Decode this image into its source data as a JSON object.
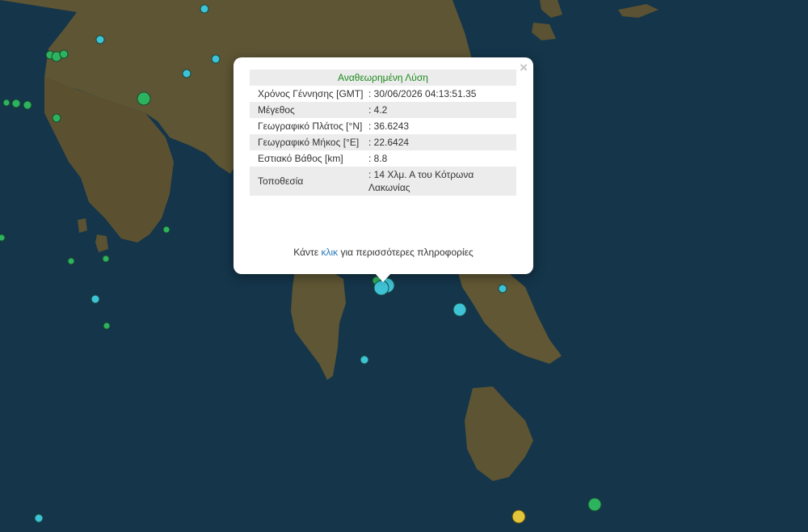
{
  "colors": {
    "sea": "#14354a",
    "land": "#5a5232",
    "quake_cyan": "#3ec3d6",
    "quake_green": "#2db35e",
    "quake_yellow": "#e2c53a",
    "popup_title": "#1d8a1d",
    "link": "#2a7ab8"
  },
  "popup": {
    "title": "Αναθεωρημένη Λύση",
    "close_icon": "×",
    "rows": [
      {
        "key": "Χρόνος Γέννησης [GMT]",
        "value": ": 30/06/2026 04:13:51.35"
      },
      {
        "key": "Μέγεθος",
        "value": ": 4.2"
      },
      {
        "key": "Γεωγραφικό Πλάτος [°N]",
        "value": ": 36.6243"
      },
      {
        "key": "Γεωγραφικό Μήκος [°E]",
        "value": ": 22.6424"
      },
      {
        "key": "Εστιακό Βάθος [km]",
        "value": ": 8.8"
      },
      {
        "key": "Τοποθεσία",
        "value": ": 14 Χλμ. Α του Κότρωνα Λακωνίας"
      }
    ],
    "more_prefix": "Κάντε ",
    "more_link": "κλικ",
    "more_suffix": " για περισσότερες πληροφορίες"
  }
}
